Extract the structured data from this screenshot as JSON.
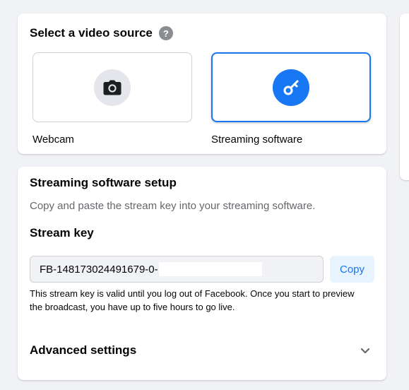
{
  "video_source": {
    "title": "Select a video source",
    "help_icon": "question-circle-icon",
    "options": [
      {
        "label": "Webcam",
        "icon": "camera-icon",
        "selected": false
      },
      {
        "label": "Streaming software",
        "icon": "key-icon",
        "selected": true
      }
    ]
  },
  "setup": {
    "title": "Streaming software setup",
    "description": "Copy and paste the stream key into your streaming software.",
    "stream_key_label": "Stream key",
    "stream_key_value": "FB-148173024491679-0-",
    "copy_label": "Copy",
    "note": "This stream key is valid until you log out of Facebook. Once you start to preview the broadcast, you have up to five hours to go live.",
    "advanced_label": "Advanced settings",
    "advanced_icon": "chevron-down-icon"
  },
  "colors": {
    "accent": "#1877f2",
    "selected_border": "#1877f2",
    "copy_bg": "#e7f3ff",
    "page_bg": "#f0f2f5"
  }
}
